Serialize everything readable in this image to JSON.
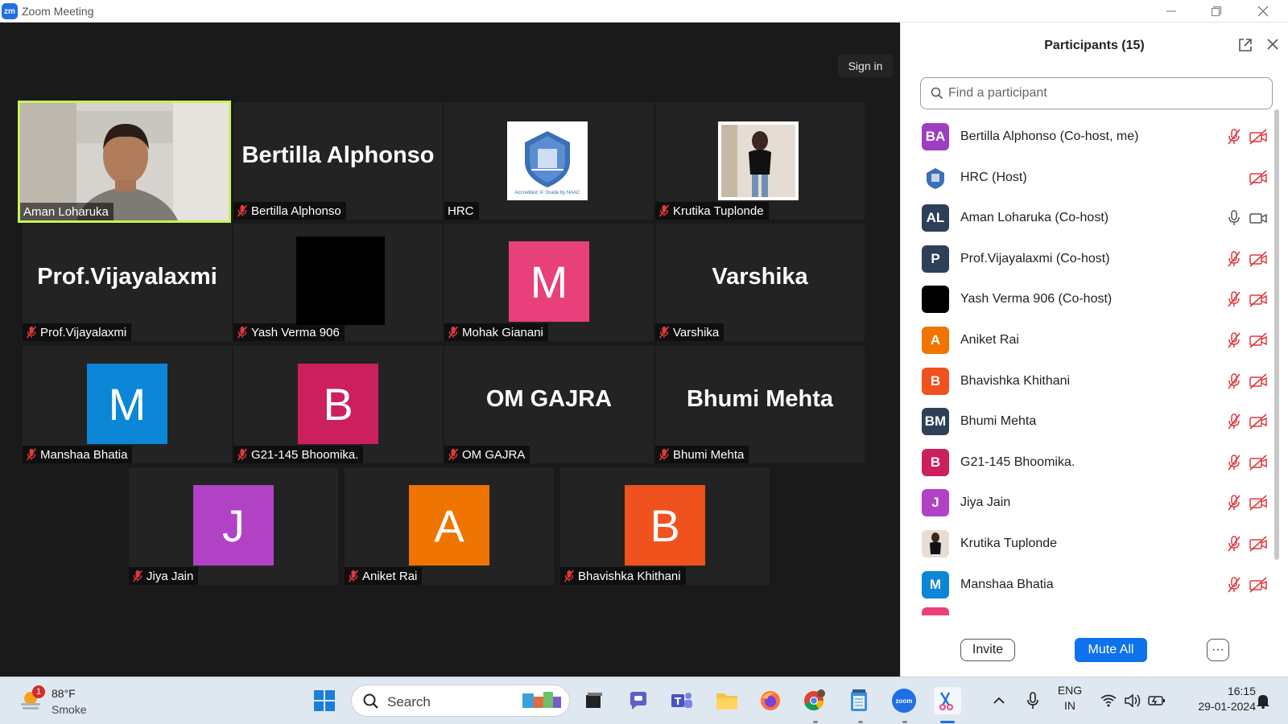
{
  "window": {
    "app_logo": "zm",
    "title": "Zoom Meeting"
  },
  "meeting": {
    "sign_in_label": "Sign in",
    "tiles": [
      {
        "name": "Aman Loharuka",
        "kind": "video",
        "muted": false,
        "active": true
      },
      {
        "name": "Bertilla Alphonso",
        "display": "Bertilla Alphonso",
        "kind": "text",
        "muted": true
      },
      {
        "name": "HRC",
        "kind": "logo",
        "logo_caption": "Accredited 'A' Grade by NAAC",
        "muted": false
      },
      {
        "name": "Krutika Tuplonde",
        "kind": "photo",
        "muted": true
      },
      {
        "name": "Prof.Vijayalaxmi",
        "display": "Prof.Vijayalaxmi",
        "kind": "text",
        "muted": true
      },
      {
        "name": "Yash Verma 906",
        "kind": "black",
        "muted": true
      },
      {
        "name": "Mohak Gianani",
        "kind": "avatar",
        "letter": "M",
        "color": "#e8407a",
        "muted": true
      },
      {
        "name": "Varshika",
        "display": "Varshika",
        "kind": "text",
        "muted": true
      },
      {
        "name": "Manshaa Bhatia",
        "kind": "avatar",
        "letter": "M",
        "color": "#0c87d8",
        "muted": true
      },
      {
        "name": "G21-145 Bhoomika.",
        "kind": "avatar",
        "letter": "B",
        "color": "#cc1f5e",
        "muted": true
      },
      {
        "name": "OM GAJRA",
        "display": "OM GAJRA",
        "kind": "text",
        "muted": true
      },
      {
        "name": "Bhumi Mehta",
        "display": "Bhumi Mehta",
        "kind": "text",
        "muted": true
      },
      {
        "name": "Jiya Jain",
        "kind": "avatar",
        "letter": "J",
        "color": "#b142c6",
        "muted": true
      },
      {
        "name": "Aniket Rai",
        "kind": "avatar",
        "letter": "A",
        "color": "#ef7500",
        "muted": true
      },
      {
        "name": "Bhavishka Khithani",
        "kind": "avatar",
        "letter": "B",
        "color": "#f0521e",
        "muted": true
      }
    ]
  },
  "panel": {
    "title": "Participants (15)",
    "search_placeholder": "Find a participant",
    "participants": [
      {
        "name": "Bertilla Alphonso (Co-host, me)",
        "initials": "BA",
        "color": "#9c3fc1",
        "mic": "muted",
        "video": "off"
      },
      {
        "name": "HRC (Host)",
        "initials": "",
        "color": "logo",
        "mic": "none",
        "video": "off"
      },
      {
        "name": "Aman Loharuka (Co-host)",
        "initials": "AL",
        "color": "#2e4058",
        "mic": "on",
        "video": "on"
      },
      {
        "name": "Prof.Vijayalaxmi (Co-host)",
        "initials": "P",
        "color": "#2e4058",
        "mic": "muted",
        "video": "off"
      },
      {
        "name": "Yash Verma 906 (Co-host)",
        "initials": "",
        "color": "#000000",
        "mic": "muted",
        "video": "off"
      },
      {
        "name": "Aniket Rai",
        "initials": "A",
        "color": "#ef7500",
        "mic": "muted",
        "video": "off"
      },
      {
        "name": "Bhavishka Khithani",
        "initials": "B",
        "color": "#f0521e",
        "mic": "muted",
        "video": "off"
      },
      {
        "name": "Bhumi Mehta",
        "initials": "BM",
        "color": "#2e4058",
        "mic": "muted",
        "video": "off"
      },
      {
        "name": "G21-145 Bhoomika.",
        "initials": "B",
        "color": "#cc1f5e",
        "mic": "muted",
        "video": "off"
      },
      {
        "name": "Jiya Jain",
        "initials": "J",
        "color": "#b142c6",
        "mic": "muted",
        "video": "off"
      },
      {
        "name": "Krutika Tuplonde",
        "initials": "",
        "color": "photo",
        "mic": "muted",
        "video": "off"
      },
      {
        "name": "Manshaa Bhatia",
        "initials": "M",
        "color": "#0c87d8",
        "mic": "muted",
        "video": "off"
      }
    ],
    "invite_label": "Invite",
    "mute_all_label": "Mute All",
    "more_label": "···"
  },
  "taskbar": {
    "weather_badge": "1",
    "weather_temp": "88°F",
    "weather_cond": "Smoke",
    "search_label": "Search",
    "lang_line1": "ENG",
    "lang_line2": "IN",
    "time": "16:15",
    "date": "29-01-2024",
    "zoom_icon_text": "zoom"
  }
}
